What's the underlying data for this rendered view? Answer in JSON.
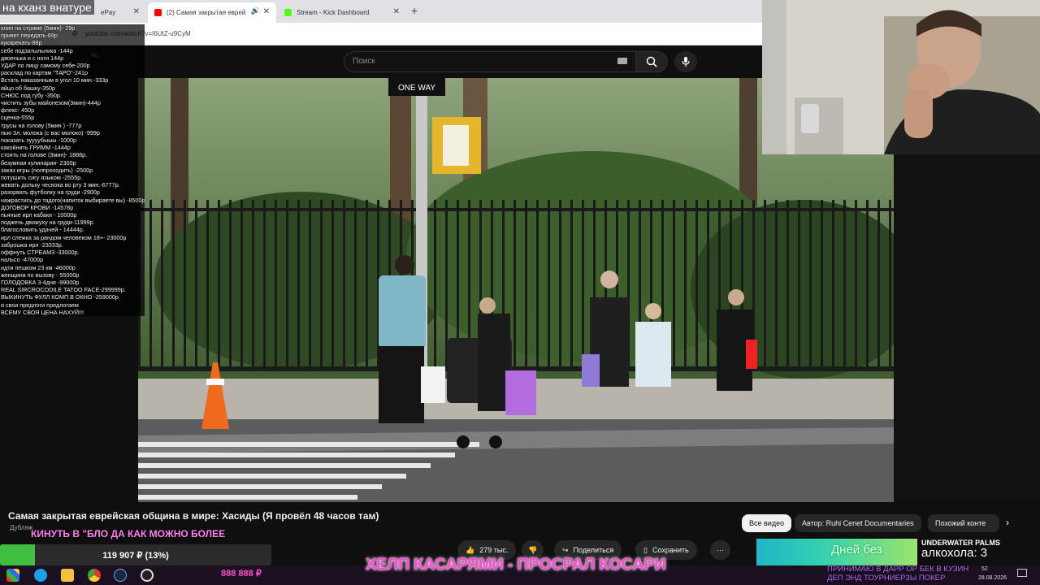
{
  "browser": {
    "tabs": [
      {
        "label": "ePay"
      },
      {
        "label": "(2) Самая закрытая еврей",
        "active": true
      },
      {
        "label": "Stream - Kick Dashboard"
      }
    ],
    "new_tab": "+",
    "url": "youtube.com/watch?v=I6UtZ-u9CyM"
  },
  "youtube": {
    "search_placeholder": "Поиск",
    "region": "RU",
    "video": {
      "sign": "ONE WAY",
      "title": "Самая закрытая еврейская община в мире: Хасиды (Я провёл 48 часов там)",
      "dub_label": "Дубляж",
      "likes": "279 тыс.",
      "share": "Поделиться",
      "save": "Сохранить",
      "more": "···"
    },
    "chips": [
      "Все видео",
      "Автор: Ruhi Cenet Documentaries",
      "Похожий конте"
    ],
    "recommend": {
      "title": "UNDERWATER PALMS",
      "thumb_text": "Дней без",
      "overlay_text": "алкохола: 3"
    }
  },
  "overlay": {
    "title": "на кханз внатуре",
    "price_list": [
      "клип на стриме (5мин)- 29р",
      "привет передать-69р",
      "кукарекать-88р",
      "себе подзатыльника -144р",
      "двоенька и с ноги 144р",
      "УДАР по лицу самому себе-200р",
      "расклад по картам \"ТАРО\"-241р",
      "Встать наказанным в угол 10 мин.-333р",
      "яйцо об башку-350р",
      "СНЮС под губу -350р.",
      "чистить зубы майонезом(3мин)-444р",
      "флекс- 450р",
      "сценка-555р",
      "трусы на голову (5мин ) -777р",
      "пью 3л. молока (с вас молоко) -999р",
      "показать зуууубыыы -1000р",
      "какойнить ГРИММ -1444р",
      "стоять на голове (3мин)- 1888р.",
      "безумная кулинария- 2300р",
      "заказ игры (полпроходить) -2500р",
      "потушить сигу языком -2555р.",
      "жевать дольку чеснока во рту 3 мин.-6777р.",
      "разорвать футболку на груди -2900р",
      "нажрастись до тадого(напиток выбираете вы) -8500р",
      "ДОГОВОР КРОВИ -14578р",
      "пьяные ирл кабаки - 10000р",
      "поджечь движуху на груди-11999р.",
      "благословить удачей - 14444р.",
      "ирл слежка за рандом человеком 18+- 23000р",
      "заброшка ирл -23333р.",
      "оффнуть СТРЕАМ3 -33000р.",
      "нальсо -47000р",
      "идти пешком 23 км -46000р",
      "женщина по вызову - 55000р",
      "ГОЛОДОВКА 3-4дня -99000р",
      "REAL SIRCROCODILE TATOO FACE-299999р.",
      "ВЫКИНУТЬ ФУЛЛ КОМП В ОКНО -259000р",
      "и свои предлоги предлогаем",
      "ВСЕМУ СВОЯ ЦЕНА НАХУЙ!!!"
    ],
    "marquee_top": "КИНУТЬ В \"БЛО ДА КАК МОЖНО БОЛЕЕ",
    "goal_text": "119 907 ₽ (13%)",
    "goal_fraction": 0.13,
    "money": "888 888 ₽",
    "big_marquee": "ХЕЛП КАСАРЯМИ - ПРОСРАЛ КОСАРИ",
    "accept_line1": "ПРИНИМАЮ В ДАРР ОР БЕК В КУЗИН",
    "accept_line2": "ДЕП ЭНД ТОУРНИЕРЗЫ ПОКЕР"
  },
  "taskbar": {
    "time": "52",
    "date": "28.08.2026"
  },
  "colors": {
    "goal_fill": "#3fbe3f",
    "marquee": "#ff49d6",
    "accept": "#b86bff"
  }
}
